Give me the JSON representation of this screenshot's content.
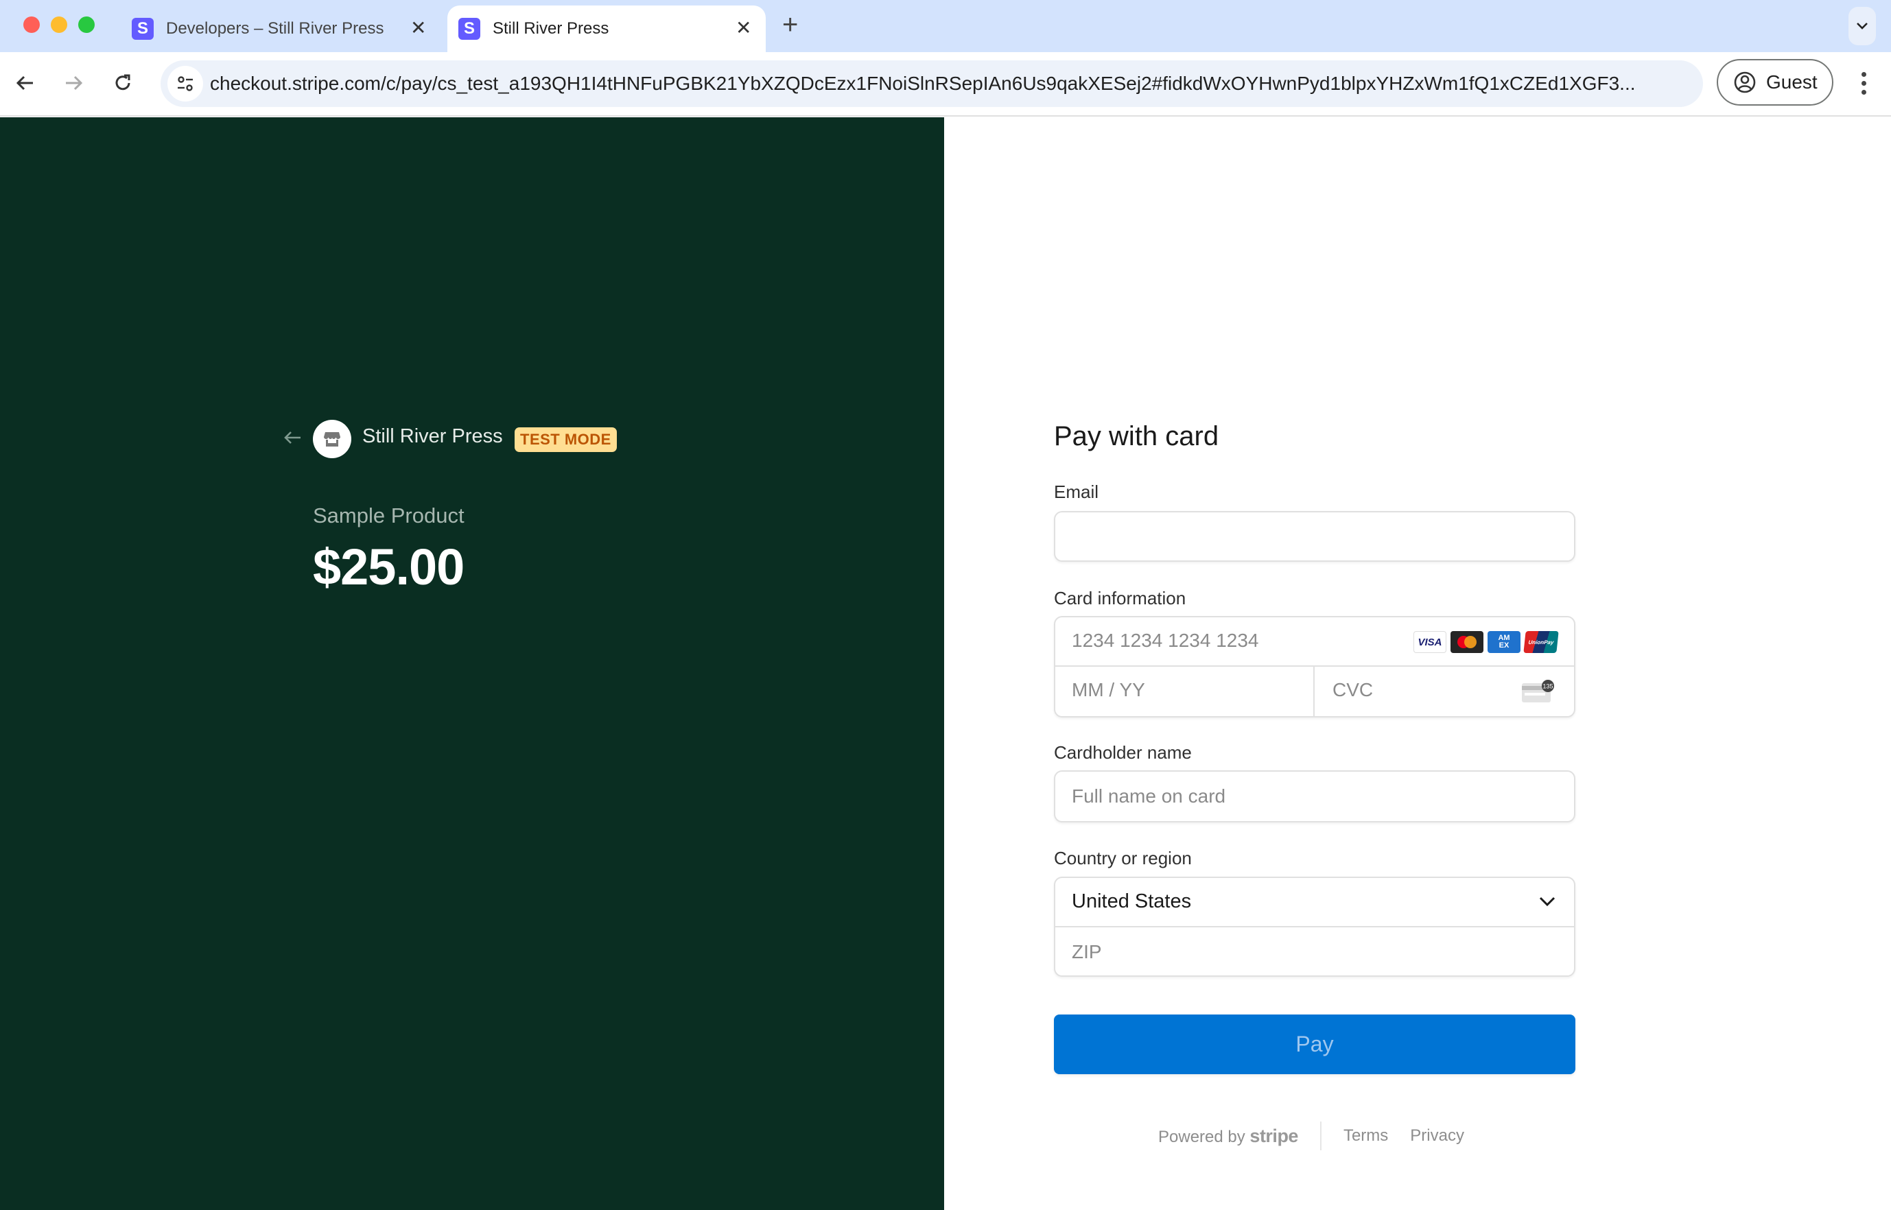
{
  "browser": {
    "tabs": [
      {
        "title": "Developers – Still River Press",
        "favicon": "S",
        "active": false
      },
      {
        "title": "Still River Press",
        "favicon": "S",
        "active": true
      }
    ],
    "url": "checkout.stripe.com/c/pay/cs_test_a193QH1I4tHNFuPGBK21YbXZQDcEzx1FNoiSlnRSepIAn6Us9qakXESej2#fidkdWxOYHwnPyd1blpxYHZxWm1fQ1xCZEd1XGF3...",
    "profile_label": "Guest",
    "icons": {
      "back": "arrow-left-icon",
      "forward": "arrow-right-icon",
      "reload": "reload-icon",
      "site_info": "tune-icon",
      "profile": "account-circle-icon",
      "menu": "kebab-menu-icon",
      "new_tab": "plus-icon",
      "tab_search": "chevron-down-icon"
    }
  },
  "summary": {
    "merchant_name": "Still River Press",
    "badge": "TEST MODE",
    "product_name": "Sample Product",
    "price": "$25.00",
    "colors": {
      "background": "#0a2e22",
      "badge_bg": "#ffde92",
      "badge_text": "#bb5504"
    }
  },
  "form": {
    "title": "Pay with card",
    "email": {
      "label": "Email",
      "value": "",
      "placeholder": ""
    },
    "card": {
      "label": "Card information",
      "number_placeholder": "1234 1234 1234 1234",
      "expiry_placeholder": "MM / YY",
      "cvc_placeholder": "CVC",
      "brands": [
        "VISA",
        "Mastercard",
        "AMEX",
        "UnionPay"
      ],
      "cvc_hint": "135"
    },
    "cardholder": {
      "label": "Cardholder name",
      "placeholder": "Full name on card"
    },
    "country": {
      "label": "Country or region",
      "selected": "United States",
      "zip_placeholder": "ZIP"
    },
    "pay_button": "Pay",
    "colors": {
      "pay_button": "#0074d4",
      "pay_text": "#9fc7ef"
    }
  },
  "footer": {
    "powered_by": "Powered by",
    "brand": "stripe",
    "links": [
      "Terms",
      "Privacy"
    ]
  }
}
